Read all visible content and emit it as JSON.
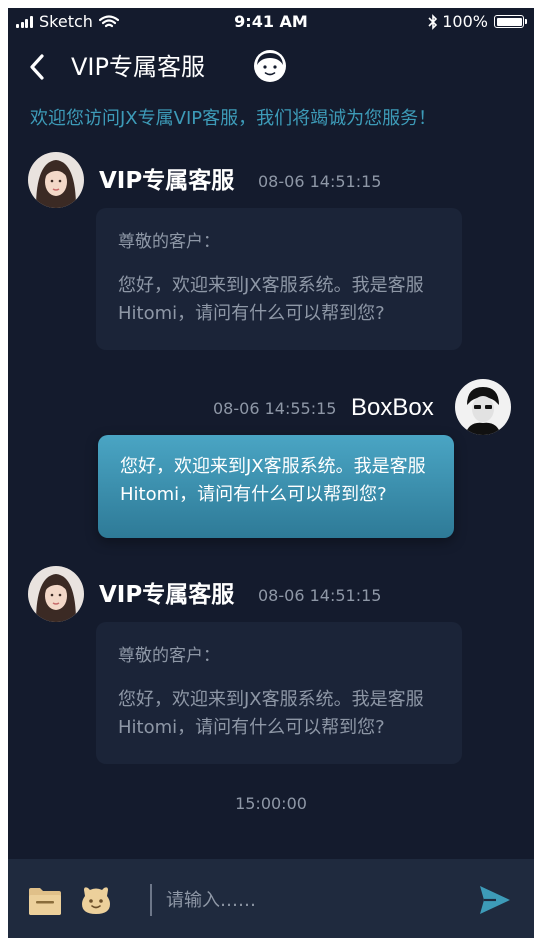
{
  "status_bar": {
    "carrier": "Sketch",
    "time": "9:41 AM",
    "battery": "100%"
  },
  "header": {
    "title": "VIP专属客服",
    "back_icon": "chevron-left-icon",
    "agent_icon": "customer-service-avatar-icon"
  },
  "welcome_banner": "欢迎您访问JX专属VIP客服，我们将竭诚为您服务！",
  "messages": [
    {
      "sender": "VIP专属客服",
      "time": "08-06 14:51:15",
      "greeting": "尊敬的客户：",
      "text": "您好，欢迎来到JX客服系统。我是客服Hitomi，请问有什么可以帮到您?"
    },
    {
      "sender": "BoxBox",
      "time": "08-06 14:55:15",
      "text": "您好，欢迎来到JX客服系统。我是客服Hitomi，请问有什么可以帮到您?"
    },
    {
      "sender": "VIP专属客服",
      "time": "08-06 14:51:15",
      "greeting": "尊敬的客户：",
      "text": "您好，欢迎来到JX客服系统。我是客服Hitomi，请问有什么可以帮到您?"
    }
  ],
  "time_divider": "15:00:00",
  "input_bar": {
    "placeholder": "请输入……",
    "folder_icon": "folder-icon",
    "emoji_icon": "emoji-icon",
    "send_icon": "send-icon"
  },
  "colors": {
    "background": "#141b2d",
    "accent": "#3d9bb8",
    "incoming_bubble": "#1b2438",
    "outgoing_bubble": "#3a8fad",
    "input_bar": "#1f2a3e"
  }
}
